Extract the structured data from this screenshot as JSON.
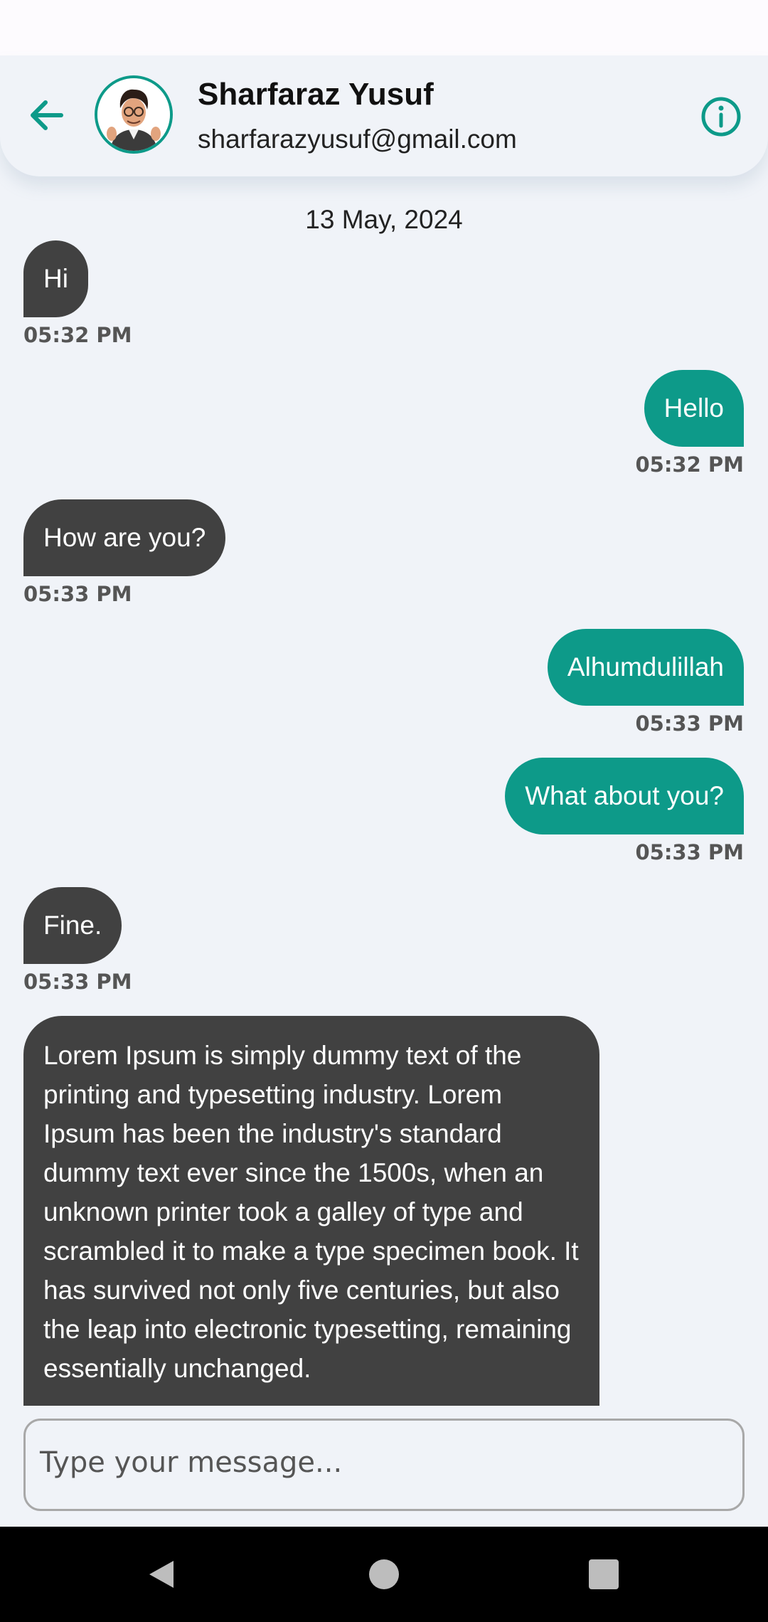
{
  "header": {
    "contact_name": "Sharfaraz Yusuf",
    "contact_email": "sharfarazyusuf@gmail.com",
    "back_icon": "arrow-back-icon",
    "info_icon": "info-circle-icon",
    "avatar": "avatar-image"
  },
  "chat": {
    "date_separator": "13 May, 2024",
    "messages": [
      {
        "direction": "incoming",
        "text": "Hi",
        "time": "05:32 PM"
      },
      {
        "direction": "outgoing",
        "text": "Hello",
        "time": "05:32 PM"
      },
      {
        "direction": "incoming",
        "text": "How are you?",
        "time": "05:33 PM"
      },
      {
        "direction": "outgoing",
        "text": "Alhumdulillah",
        "time": "05:33 PM"
      },
      {
        "direction": "outgoing",
        "text": "What about you?",
        "time": "05:33 PM"
      },
      {
        "direction": "incoming",
        "text": "Fine.",
        "time": "05:33 PM"
      },
      {
        "direction": "incoming",
        "text": "Lorem Ipsum is simply dummy text of the printing and typesetting industry. Lorem Ipsum has been the industry's standard dummy text ever since the 1500s, when an unknown printer took a galley of type and scrambled it to make a type specimen book. It has survived not only five centuries, but also the leap into electronic typesetting, remaining essentially unchanged."
      }
    ]
  },
  "composer": {
    "placeholder": "Type your message..."
  },
  "colors": {
    "accent": "#0d9a89",
    "incoming_bubble": "#414141",
    "background": "#f0f3f8"
  },
  "navbar": {
    "back_icon": "nav-back-icon",
    "home_icon": "nav-home-icon",
    "recents_icon": "nav-recents-icon"
  }
}
